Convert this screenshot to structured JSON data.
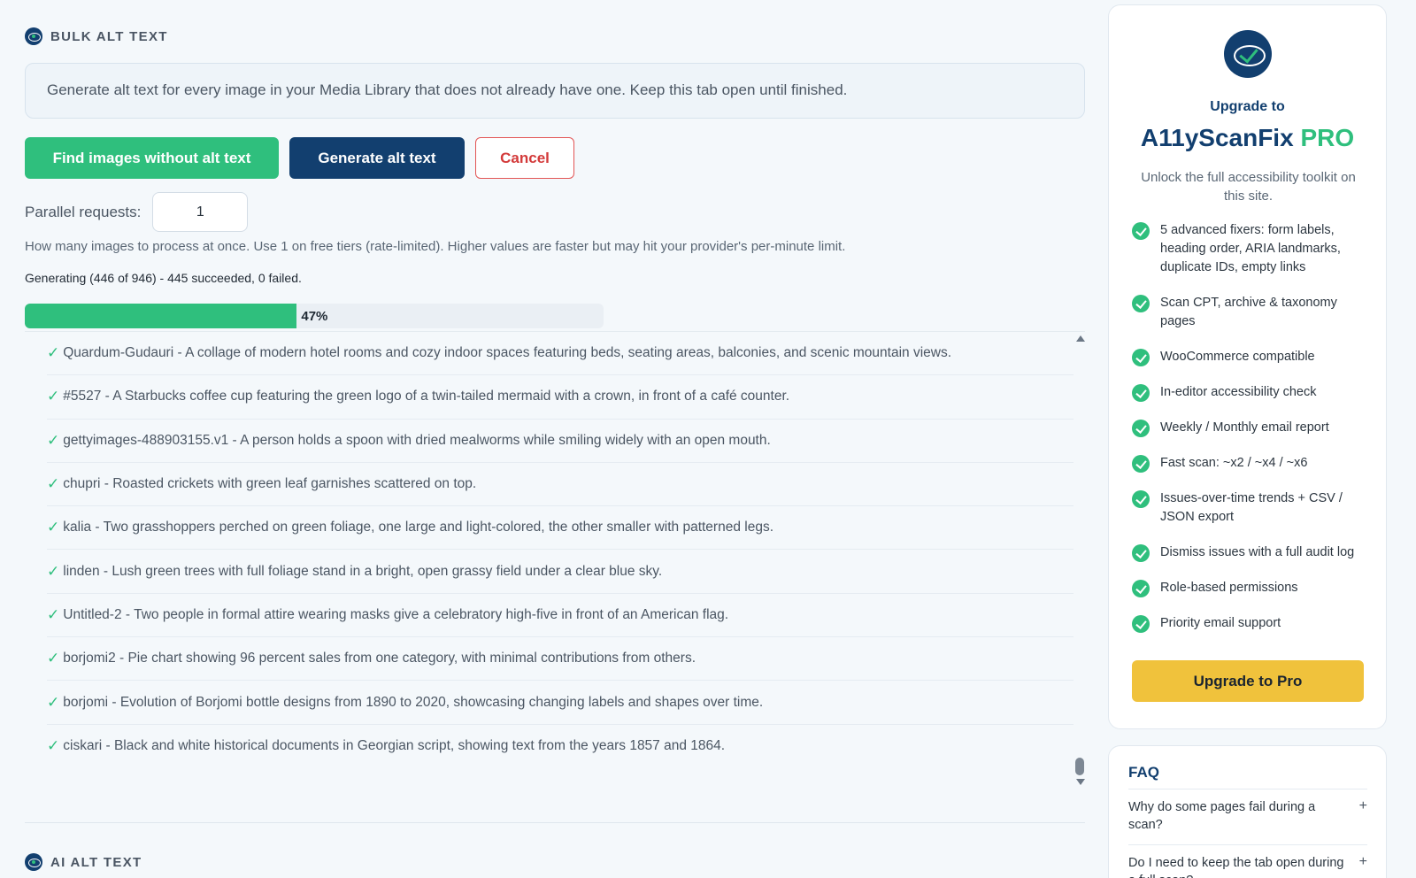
{
  "bulk": {
    "title": "BULK ALT TEXT",
    "notice": "Generate alt text for every image in your Media Library that does not already have one. Keep this tab open until finished.",
    "buttons": {
      "find": "Find images without alt text",
      "generate": "Generate alt text",
      "cancel": "Cancel"
    },
    "parallel_label": "Parallel requests:",
    "parallel_value": "1",
    "help": "How many images to process at once. Use 1 on free tiers (rate-limited). Higher values are faster but may hit your provider's per-minute limit.",
    "status": "Generating (446 of 946) - 445 succeeded, 0 failed.",
    "progress_percent": 47,
    "progress_label": "47%",
    "check_glyph": "✓",
    "results": [
      {
        "text": "Quardum-Gudauri - A collage of modern hotel rooms and cozy indoor spaces featuring beds, seating areas, balconies, and scenic mountain views."
      },
      {
        "text": "#5527 - A Starbucks coffee cup featuring the green logo of a twin-tailed mermaid with a crown, in front of a café counter."
      },
      {
        "text": "gettyimages-488903155.v1 - A person holds a spoon with dried mealworms while smiling widely with an open mouth."
      },
      {
        "text": "chupri - Roasted crickets with green leaf garnishes scattered on top."
      },
      {
        "text": "kalia - Two grasshoppers perched on green foliage, one large and light-colored, the other smaller with patterned legs."
      },
      {
        "text": "linden - Lush green trees with full foliage stand in a bright, open grassy field under a clear blue sky."
      },
      {
        "text": "Untitled-2 - Two people in formal attire wearing masks give a celebratory high-five in front of an American flag."
      },
      {
        "text": "borjomi2 - Pie chart showing 96 percent sales from one category, with minimal contributions from others."
      },
      {
        "text": "borjomi - Evolution of Borjomi bottle designs from 1890 to 2020, showcasing changing labels and shapes over time."
      },
      {
        "text": "ciskari - Black and white historical documents in Georgian script, showing text from the years 1857 and 1864."
      }
    ]
  },
  "ai": {
    "title": "AI ALT TEXT"
  },
  "pro": {
    "upgrade_to": "Upgrade to",
    "product": "A11yScanFix",
    "pro_word": "PRO",
    "subtitle": "Unlock the full accessibility toolkit on this site.",
    "features": [
      {
        "text": "5 advanced fixers: form labels, heading order, ARIA landmarks, duplicate IDs, empty links"
      },
      {
        "text": "Scan CPT, archive & taxonomy pages"
      },
      {
        "text": "WooCommerce compatible"
      },
      {
        "text": "In-editor accessibility check"
      },
      {
        "text": "Weekly / Monthly email report"
      },
      {
        "text": "Fast scan: ~x2 / ~x4 / ~x6"
      },
      {
        "text": "Issues-over-time trends + CSV / JSON export"
      },
      {
        "text": "Dismiss issues with a full audit log"
      },
      {
        "text": "Role-based permissions"
      },
      {
        "text": "Priority email support"
      }
    ],
    "button": "Upgrade to Pro"
  },
  "faq": {
    "title": "FAQ",
    "plus_glyph": "+",
    "items": [
      {
        "q": "Why do some pages fail during a scan?"
      },
      {
        "q": "Do I need to keep the tab open during a full scan?"
      }
    ]
  },
  "colors": {
    "accent_green": "#2fbf7d",
    "brand_navy": "#123f6f",
    "cancel_red": "#d33a3a",
    "upgrade_yellow": "#f0c23c"
  },
  "icons": {
    "section_icon": "eye-check-logo-icon",
    "pro_logo": "eye-check-logo-icon",
    "feature_icon": "check-circle-icon",
    "result_icon": "check-icon",
    "faq_icon": "plus-icon"
  }
}
